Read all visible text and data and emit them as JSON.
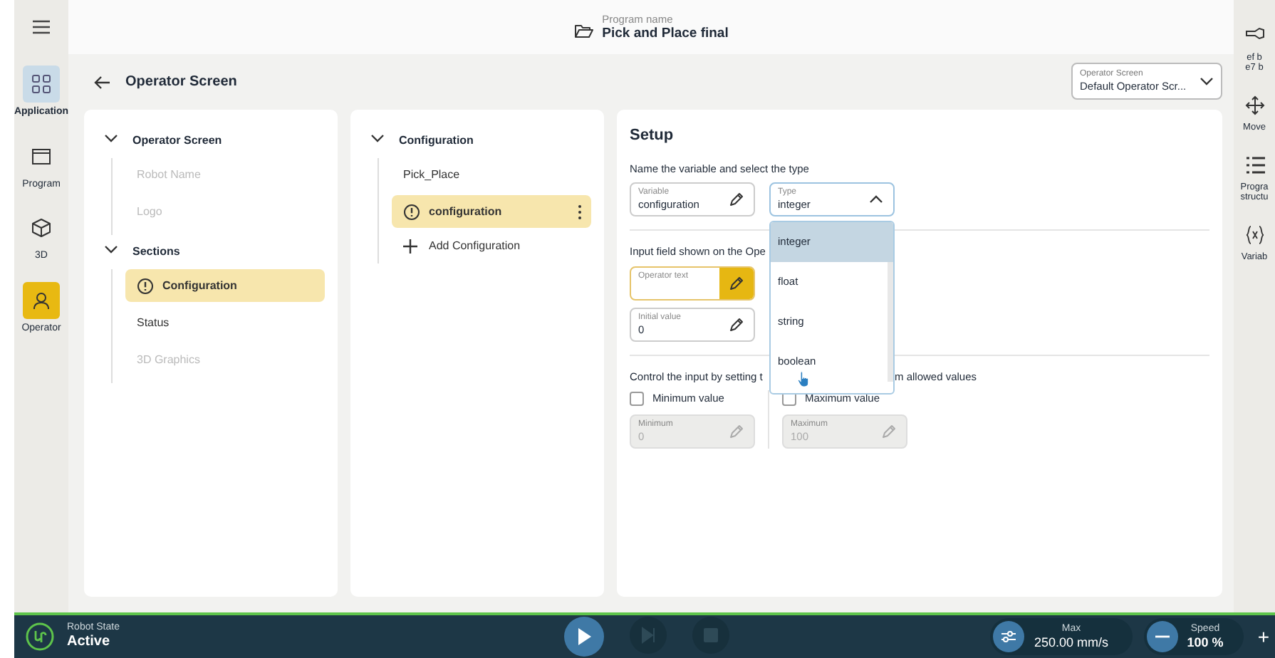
{
  "top_bar": {
    "caption": "Program name",
    "title": "Pick and Place final"
  },
  "nav": [
    {
      "label": "Application",
      "kind": "section"
    },
    {
      "label": "Program",
      "kind": "normal"
    },
    {
      "label": "3D",
      "kind": "normal"
    },
    {
      "label": "Operator",
      "kind": "active"
    }
  ],
  "header": {
    "title": "Operator Screen",
    "screen_select": {
      "label": "Operator Screen",
      "value": "Default Operator Scr..."
    }
  },
  "sections_tree": [
    {
      "label": "Operator Screen",
      "expanded": true,
      "children": [
        {
          "label": "Robot Name",
          "disabled": true,
          "selected": false,
          "warning": false
        },
        {
          "label": "Logo",
          "disabled": true,
          "selected": false,
          "warning": false
        }
      ]
    },
    {
      "label": "Sections",
      "expanded": true,
      "children": [
        {
          "label": "Configuration",
          "disabled": false,
          "selected": true,
          "warning": true
        },
        {
          "label": "Status",
          "disabled": false,
          "selected": false,
          "warning": false
        },
        {
          "label": "3D Graphics",
          "disabled": true,
          "selected": false,
          "warning": false
        }
      ]
    }
  ],
  "config_tree": {
    "label": "Configuration",
    "expanded": true,
    "children": [
      {
        "label": "Pick_Place",
        "selected": false,
        "warning": false
      },
      {
        "label": "configuration",
        "selected": true,
        "warning": true
      }
    ],
    "add_label": "Add Configuration"
  },
  "setup": {
    "title": "Setup",
    "prompt": "Name the variable and select the type",
    "variable": {
      "label": "Variable",
      "value": "configuration"
    },
    "type": {
      "label": "Type",
      "value": "integer",
      "expanded": true,
      "options": [
        {
          "label": "integer",
          "selected": true
        },
        {
          "label": "float",
          "selected": false
        },
        {
          "label": "string",
          "selected": false
        },
        {
          "label": "boolean",
          "selected": false
        }
      ]
    },
    "input_heading": "Input field shown on the Ope",
    "operator_text": {
      "label": "Operator text"
    },
    "initial_value": {
      "label": "Initial value",
      "value": "0"
    },
    "control_text": [
      "Control the input by setting t",
      "m allowed values"
    ],
    "limits": [
      {
        "checkbox_label": "Minimum value",
        "checked": false,
        "label": "Minimum",
        "value": "0",
        "disabled": true
      },
      {
        "checkbox_label": "Maximum value",
        "checked": false,
        "label": "Maximum",
        "value": "100",
        "disabled": true
      }
    ]
  },
  "right_rail": [
    {
      "kind": "gripper",
      "lines": [
        "ef b",
        "e7 b"
      ]
    },
    {
      "kind": "move",
      "lines": [
        "Move"
      ]
    },
    {
      "kind": "list",
      "lines": [
        "Progra",
        "structu"
      ]
    },
    {
      "kind": "variable",
      "lines": [
        "Variab"
      ]
    }
  ],
  "status_bar": {
    "caption": "Robot State",
    "state": "Active",
    "max_caption": "Max",
    "max_value": "250.00 mm/s",
    "speed_caption": "Speed",
    "speed_value": "100 %",
    "plus": "+"
  }
}
